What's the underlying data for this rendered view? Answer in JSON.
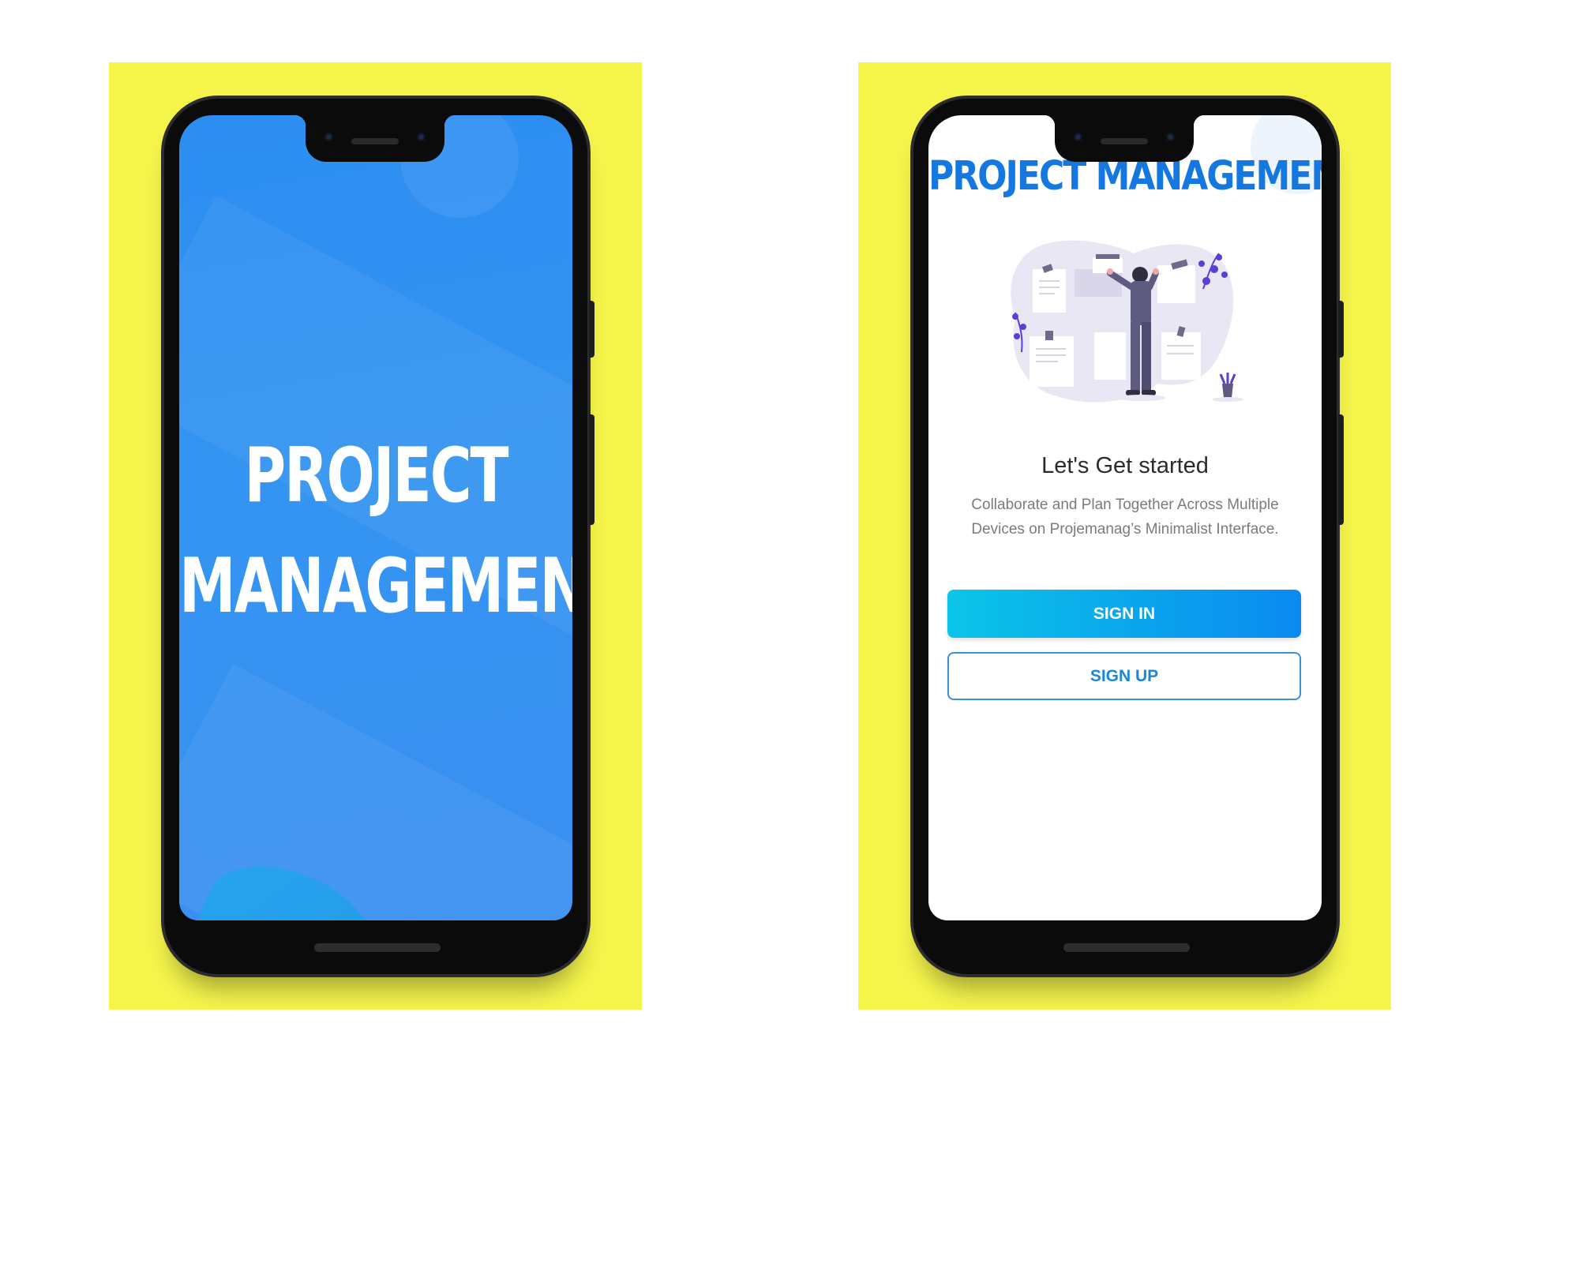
{
  "left_phone": {
    "splash_title_line1": "PROJECT",
    "splash_title_line2": "MANAGEMENT"
  },
  "right_phone": {
    "logo_text": "PROJECT MANAGEMENT",
    "heading": "Let's Get started",
    "description": "Collaborate and Plan Together Across Multiple Devices on Projemanag’s Minimalist Interface.",
    "sign_in_label": "SIGN IN",
    "sign_up_label": "SIGN UP"
  },
  "colors": {
    "backdrop": "#f4f44b",
    "splash_blue": "#3494f1",
    "brand_blue": "#1478e0",
    "signin_gradient_start": "#0bc5e8",
    "signin_gradient_end": "#0a8af0"
  }
}
